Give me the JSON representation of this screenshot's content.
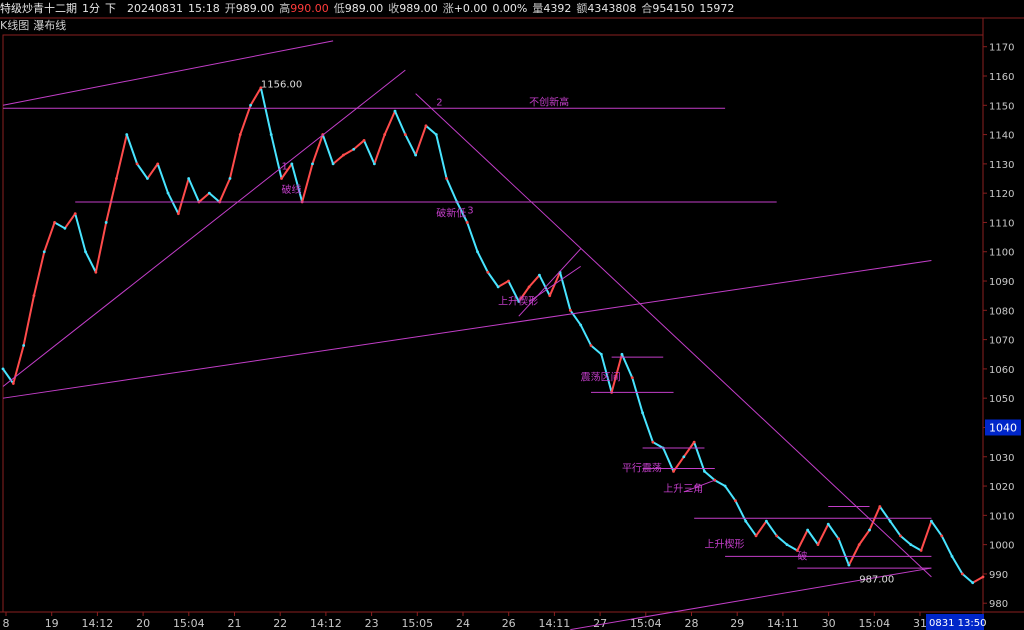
{
  "header": {
    "instrument": "特级炒青十二期",
    "period": "1分",
    "direction": "下",
    "date": "20240831",
    "time": "15:18",
    "open_label": "开",
    "open": "989.00",
    "high_label": "高",
    "high": "990.00",
    "low_label": "低",
    "low": "989.00",
    "close_label": "收",
    "close": "989.00",
    "change_label": "涨",
    "change": "+0.00",
    "change_pct": "0.00%",
    "volume_label": "量",
    "volume": "4392",
    "amount_label": "额",
    "amount": "4343808",
    "hold_label": "合",
    "hold": "954150",
    "extra": "15972"
  },
  "subheader": {
    "kline_label": "K线图",
    "waterfall_label": "瀑布线"
  },
  "colors": {
    "up": "#ff4b4b",
    "down": "#48e4ff",
    "annotation": "#c23ec8",
    "grid": "#8a1f1f",
    "axis_text": "#c8c8c8",
    "price_tag_bg": "#0026c9"
  },
  "chart_data": {
    "type": "line",
    "title": "",
    "ylim": [
      977,
      1174
    ],
    "yticks": [
      980,
      990,
      1000,
      1010,
      1020,
      1030,
      1040,
      1050,
      1060,
      1070,
      1080,
      1090,
      1100,
      1110,
      1120,
      1130,
      1140,
      1150,
      1160,
      1170
    ],
    "current_price_tag": "1040",
    "x_tick_labels": [
      "8",
      "19",
      "14:12",
      "20",
      "15:04",
      "21",
      "22",
      "14:12",
      "23",
      "15:05",
      "24",
      "26",
      "14:11",
      "27",
      "15:04",
      "28",
      "29",
      "14:11",
      "30",
      "15:04",
      "31"
    ],
    "x_time_tag": "0831 13:50",
    "series": [
      {
        "values": [
          1060,
          1055,
          1068,
          1085,
          1100,
          1110,
          1108,
          1113,
          1100,
          1093,
          1110,
          1125,
          1140,
          1130,
          1125,
          1130,
          1120,
          1113,
          1125,
          1117,
          1120,
          1117,
          1125,
          1140,
          1150,
          1156,
          1140,
          1125,
          1130,
          1117,
          1130,
          1140,
          1130,
          1133,
          1135,
          1138,
          1130,
          1140,
          1148,
          1140,
          1133,
          1143,
          1140,
          1125,
          1117,
          1110,
          1100,
          1093,
          1088,
          1090,
          1083,
          1088,
          1092,
          1085,
          1093,
          1080,
          1075,
          1068,
          1065,
          1052,
          1065,
          1057,
          1045,
          1035,
          1033,
          1025,
          1030,
          1035,
          1025,
          1022,
          1020,
          1015,
          1008,
          1003,
          1008,
          1003,
          1000,
          998,
          1005,
          1000,
          1007,
          1002,
          993,
          1000,
          1005,
          1013,
          1008,
          1003,
          1000,
          998,
          1008,
          1003,
          996,
          990,
          987,
          989
        ]
      }
    ],
    "annotations": [
      {
        "text": "1156.00",
        "x": 25,
        "y": 1156
      },
      {
        "text": "1",
        "x": 27,
        "y": 1128
      },
      {
        "text": "破线",
        "x": 27,
        "y": 1120
      },
      {
        "text": "2",
        "x": 42,
        "y": 1150
      },
      {
        "text": "不创新高",
        "x": 51,
        "y": 1150
      },
      {
        "text": "3",
        "x": 45,
        "y": 1113
      },
      {
        "text": "破新低",
        "x": 42,
        "y": 1112
      },
      {
        "text": "上升楔形",
        "x": 48,
        "y": 1082
      },
      {
        "text": "震荡区间",
        "x": 56,
        "y": 1056
      },
      {
        "text": "平行震荡",
        "x": 60,
        "y": 1025
      },
      {
        "text": "上升三角",
        "x": 64,
        "y": 1018
      },
      {
        "text": "上升楔形",
        "x": 68,
        "y": 999
      },
      {
        "text": "破",
        "x": 77,
        "y": 995
      },
      {
        "text": "987.00",
        "x": 83,
        "y": 987
      }
    ],
    "trendlines": [
      {
        "from": [
          0,
          1150
        ],
        "to": [
          32,
          1172
        ]
      },
      {
        "from": [
          0,
          1054
        ],
        "to": [
          39,
          1162
        ]
      },
      {
        "from": [
          0,
          1149
        ],
        "to": [
          70,
          1149
        ]
      },
      {
        "from": [
          7,
          1117
        ],
        "to": [
          75,
          1117
        ]
      },
      {
        "from": [
          40,
          1154
        ],
        "to": [
          90,
          989
        ]
      },
      {
        "from": [
          0,
          1050
        ],
        "to": [
          90,
          1097
        ]
      },
      {
        "from": [
          55,
          971
        ],
        "to": [
          90,
          992
        ]
      },
      {
        "from": [
          50,
          1078
        ],
        "to": [
          56,
          1101
        ]
      },
      {
        "from": [
          51,
          1083
        ],
        "to": [
          56,
          1095
        ]
      },
      {
        "from": [
          59,
          1064
        ],
        "to": [
          64,
          1064
        ]
      },
      {
        "from": [
          57,
          1052
        ],
        "to": [
          65,
          1052
        ]
      },
      {
        "from": [
          62,
          1033
        ],
        "to": [
          68,
          1033
        ]
      },
      {
        "from": [
          62,
          1026
        ],
        "to": [
          69,
          1026
        ]
      },
      {
        "from": [
          66,
          1018
        ],
        "to": [
          69,
          1022
        ]
      },
      {
        "from": [
          67,
          1009
        ],
        "to": [
          90,
          1009
        ]
      },
      {
        "from": [
          70,
          996
        ],
        "to": [
          90,
          996
        ]
      },
      {
        "from": [
          77,
          992
        ],
        "to": [
          90,
          992
        ]
      },
      {
        "from": [
          80,
          1013
        ],
        "to": [
          84,
          1013
        ]
      }
    ]
  }
}
